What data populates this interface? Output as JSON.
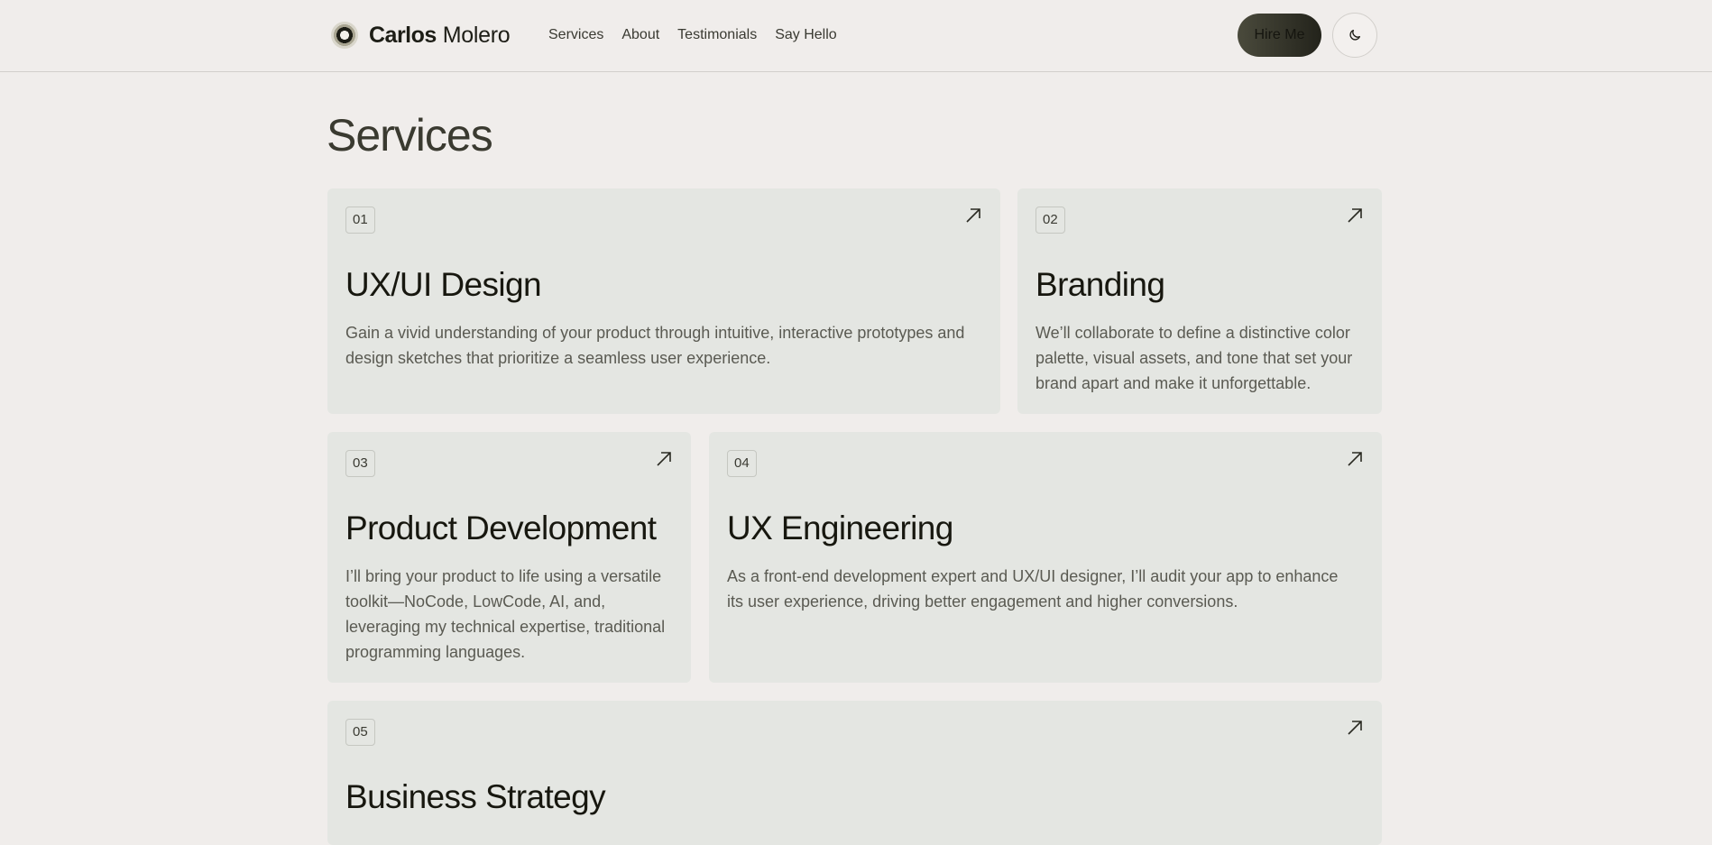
{
  "brand": {
    "first_name": "Carlos",
    "last_name": "Molero"
  },
  "nav": [
    "Services",
    "About",
    "Testimonials",
    "Say Hello"
  ],
  "hire_button": "Hire Me",
  "theme_toggle_icon": "moon-icon",
  "page_title": "Services",
  "services": [
    {
      "num": "01",
      "title": "UX/UI Design",
      "desc": "Gain a vivid understanding of your product through intuitive, interactive prototypes and design sketches that prioritize a seamless user experience."
    },
    {
      "num": "02",
      "title": "Branding",
      "desc": "We’ll collaborate to define a distinctive color palette, visual assets, and tone that set your brand apart and make it unforgettable."
    },
    {
      "num": "03",
      "title": "Product Development",
      "desc": "I’ll bring your product to life using a versatile toolkit—NoCode, LowCode, AI, and, leveraging my technical expertise, traditional programming languages."
    },
    {
      "num": "04",
      "title": "UX Engineering",
      "desc": "As a front-end development expert and UX/UI designer, I’ll audit your app to enhance its user experience, driving better engagement and higher conversions."
    },
    {
      "num": "05",
      "title": "Business Strategy",
      "desc": ""
    }
  ],
  "card_icon": "arrow-up-right-icon",
  "colors": {
    "background": "#f0edeb",
    "card": "#e4e6e2",
    "accent_dark": "#2b2b22"
  }
}
